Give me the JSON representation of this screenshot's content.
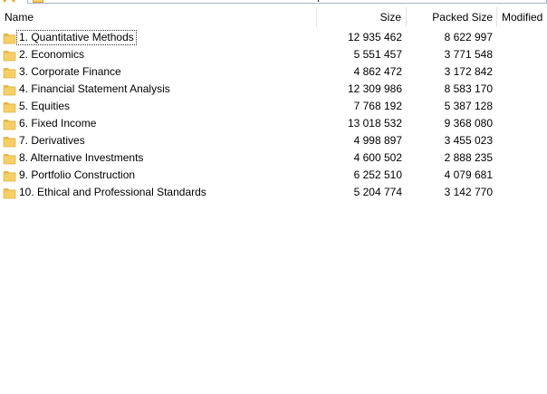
{
  "columns": {
    "name": "Name",
    "size": "Size",
    "packed": "Packed Size",
    "modified": "Modified"
  },
  "colors": {
    "folder_fill": "#f6d067",
    "folder_tab": "#e9b94a",
    "folder_edge": "#d6a731",
    "header_separator": "#e5e5e5"
  },
  "icons": {
    "row": "folder-icon"
  },
  "rows": [
    {
      "name": "1. Quantitative Methods",
      "size": "12 935 462",
      "packed": "8 622 997"
    },
    {
      "name": "2. Economics",
      "size": "5 551 457",
      "packed": "3 771 548"
    },
    {
      "name": "3. Corporate Finance",
      "size": "4 862 472",
      "packed": "3 172 842"
    },
    {
      "name": "4. Financial Statement Analysis",
      "size": "12 309 986",
      "packed": "8 583 170"
    },
    {
      "name": "5. Equities",
      "size": "7 768 192",
      "packed": "5 387 128"
    },
    {
      "name": "6. Fixed Income",
      "size": "13 018 532",
      "packed": "9 368 080"
    },
    {
      "name": "7. Derivatives",
      "size": "4 998 897",
      "packed": "3 455 023"
    },
    {
      "name": "8. Alternative Investments",
      "size": "4 600 502",
      "packed": "2 888 235"
    },
    {
      "name": "9. Portfolio Construction",
      "size": "6 252 510",
      "packed": "4 079 681"
    },
    {
      "name": "10. Ethical and Professional Standards",
      "size": "5 204 774",
      "packed": "3 142 770"
    }
  ]
}
